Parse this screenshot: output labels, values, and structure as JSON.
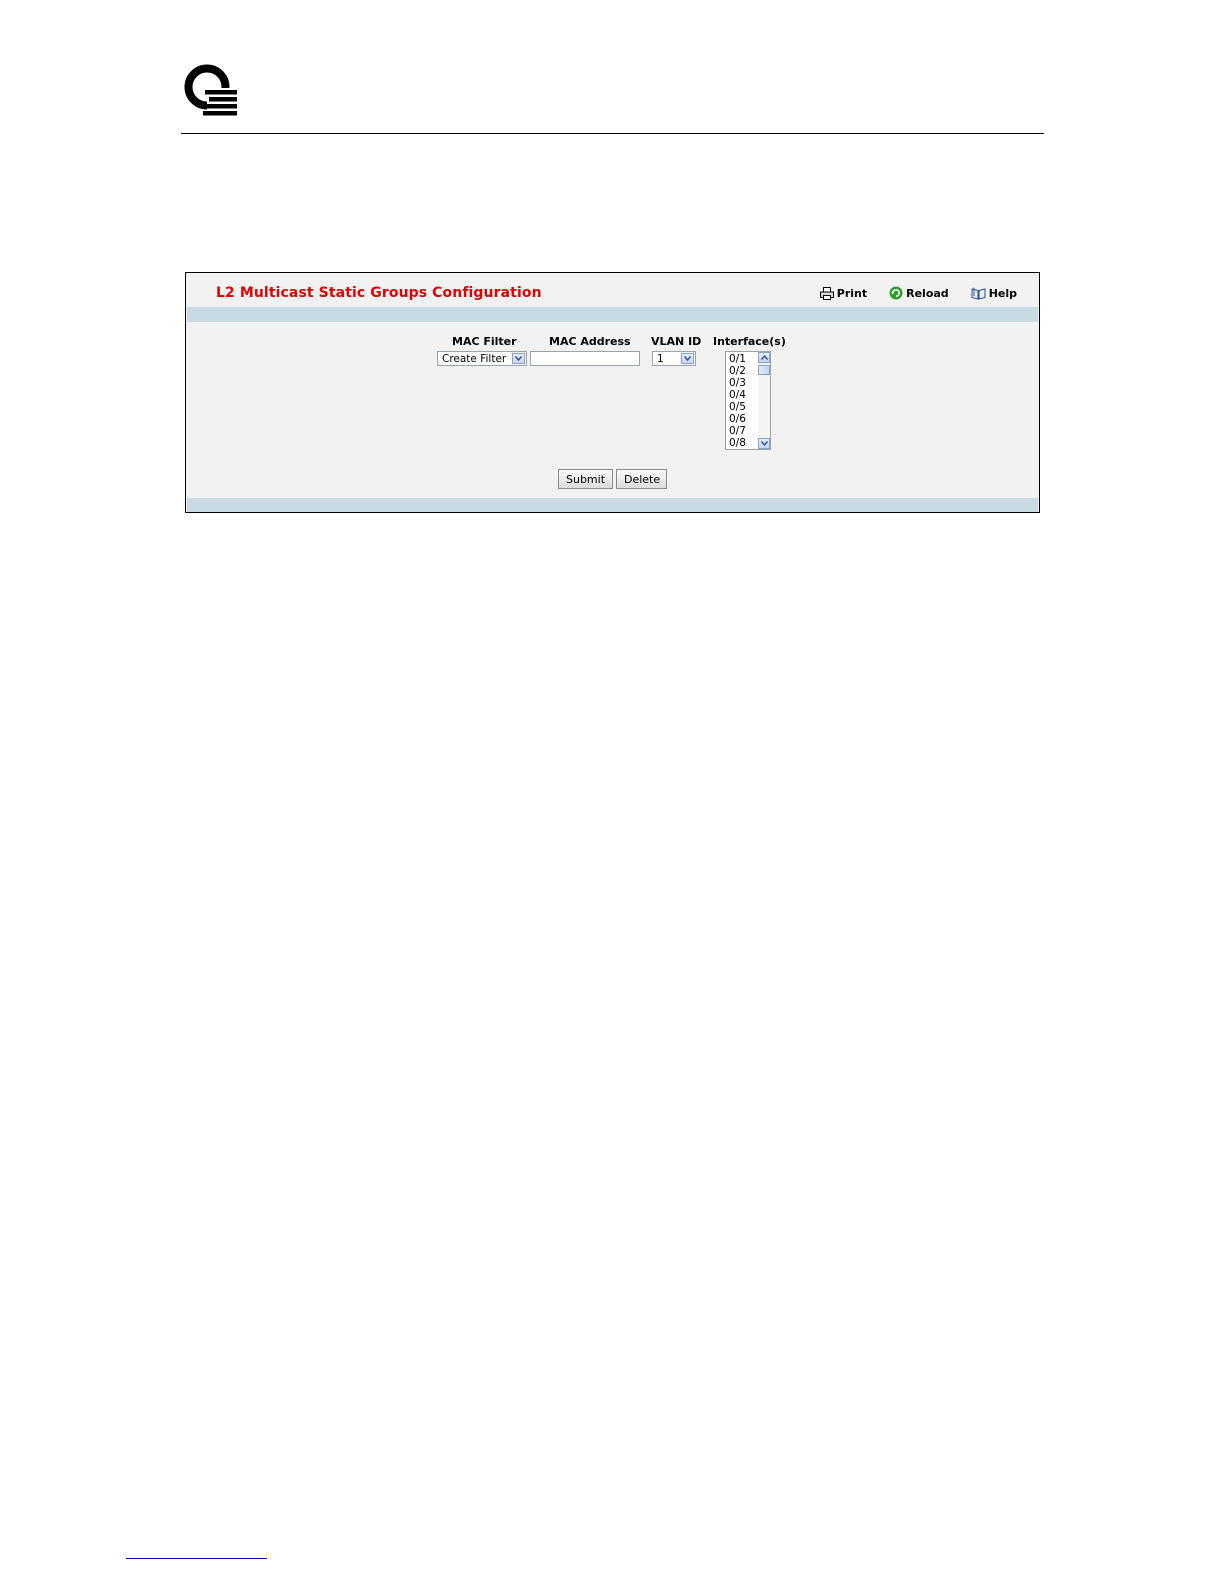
{
  "panel": {
    "title": "L2 Multicast Static Groups Configuration"
  },
  "toolbar": {
    "print_label": "Print",
    "reload_label": "Reload",
    "help_label": "Help"
  },
  "form": {
    "mac_filter": {
      "label": "MAC Filter",
      "selected": "Create Filter"
    },
    "mac_address": {
      "label": "MAC Address",
      "value": ""
    },
    "vlan_id": {
      "label": "VLAN ID",
      "selected": "1"
    },
    "interfaces": {
      "label": "Interface(s)",
      "options": [
        "0/1",
        "0/2",
        "0/3",
        "0/4",
        "0/5",
        "0/6",
        "0/7",
        "0/8"
      ]
    }
  },
  "buttons": {
    "submit_label": "Submit",
    "delete_label": "Delete"
  },
  "icons": {
    "logo": "company-logo",
    "print": "printer-icon",
    "reload": "reload-icon",
    "help": "book-icon"
  },
  "colors": {
    "title": "#e00000",
    "band": "#c8dbe5",
    "panel_bg": "#f2f2f2",
    "reload_icon": "#2e9e2e"
  }
}
